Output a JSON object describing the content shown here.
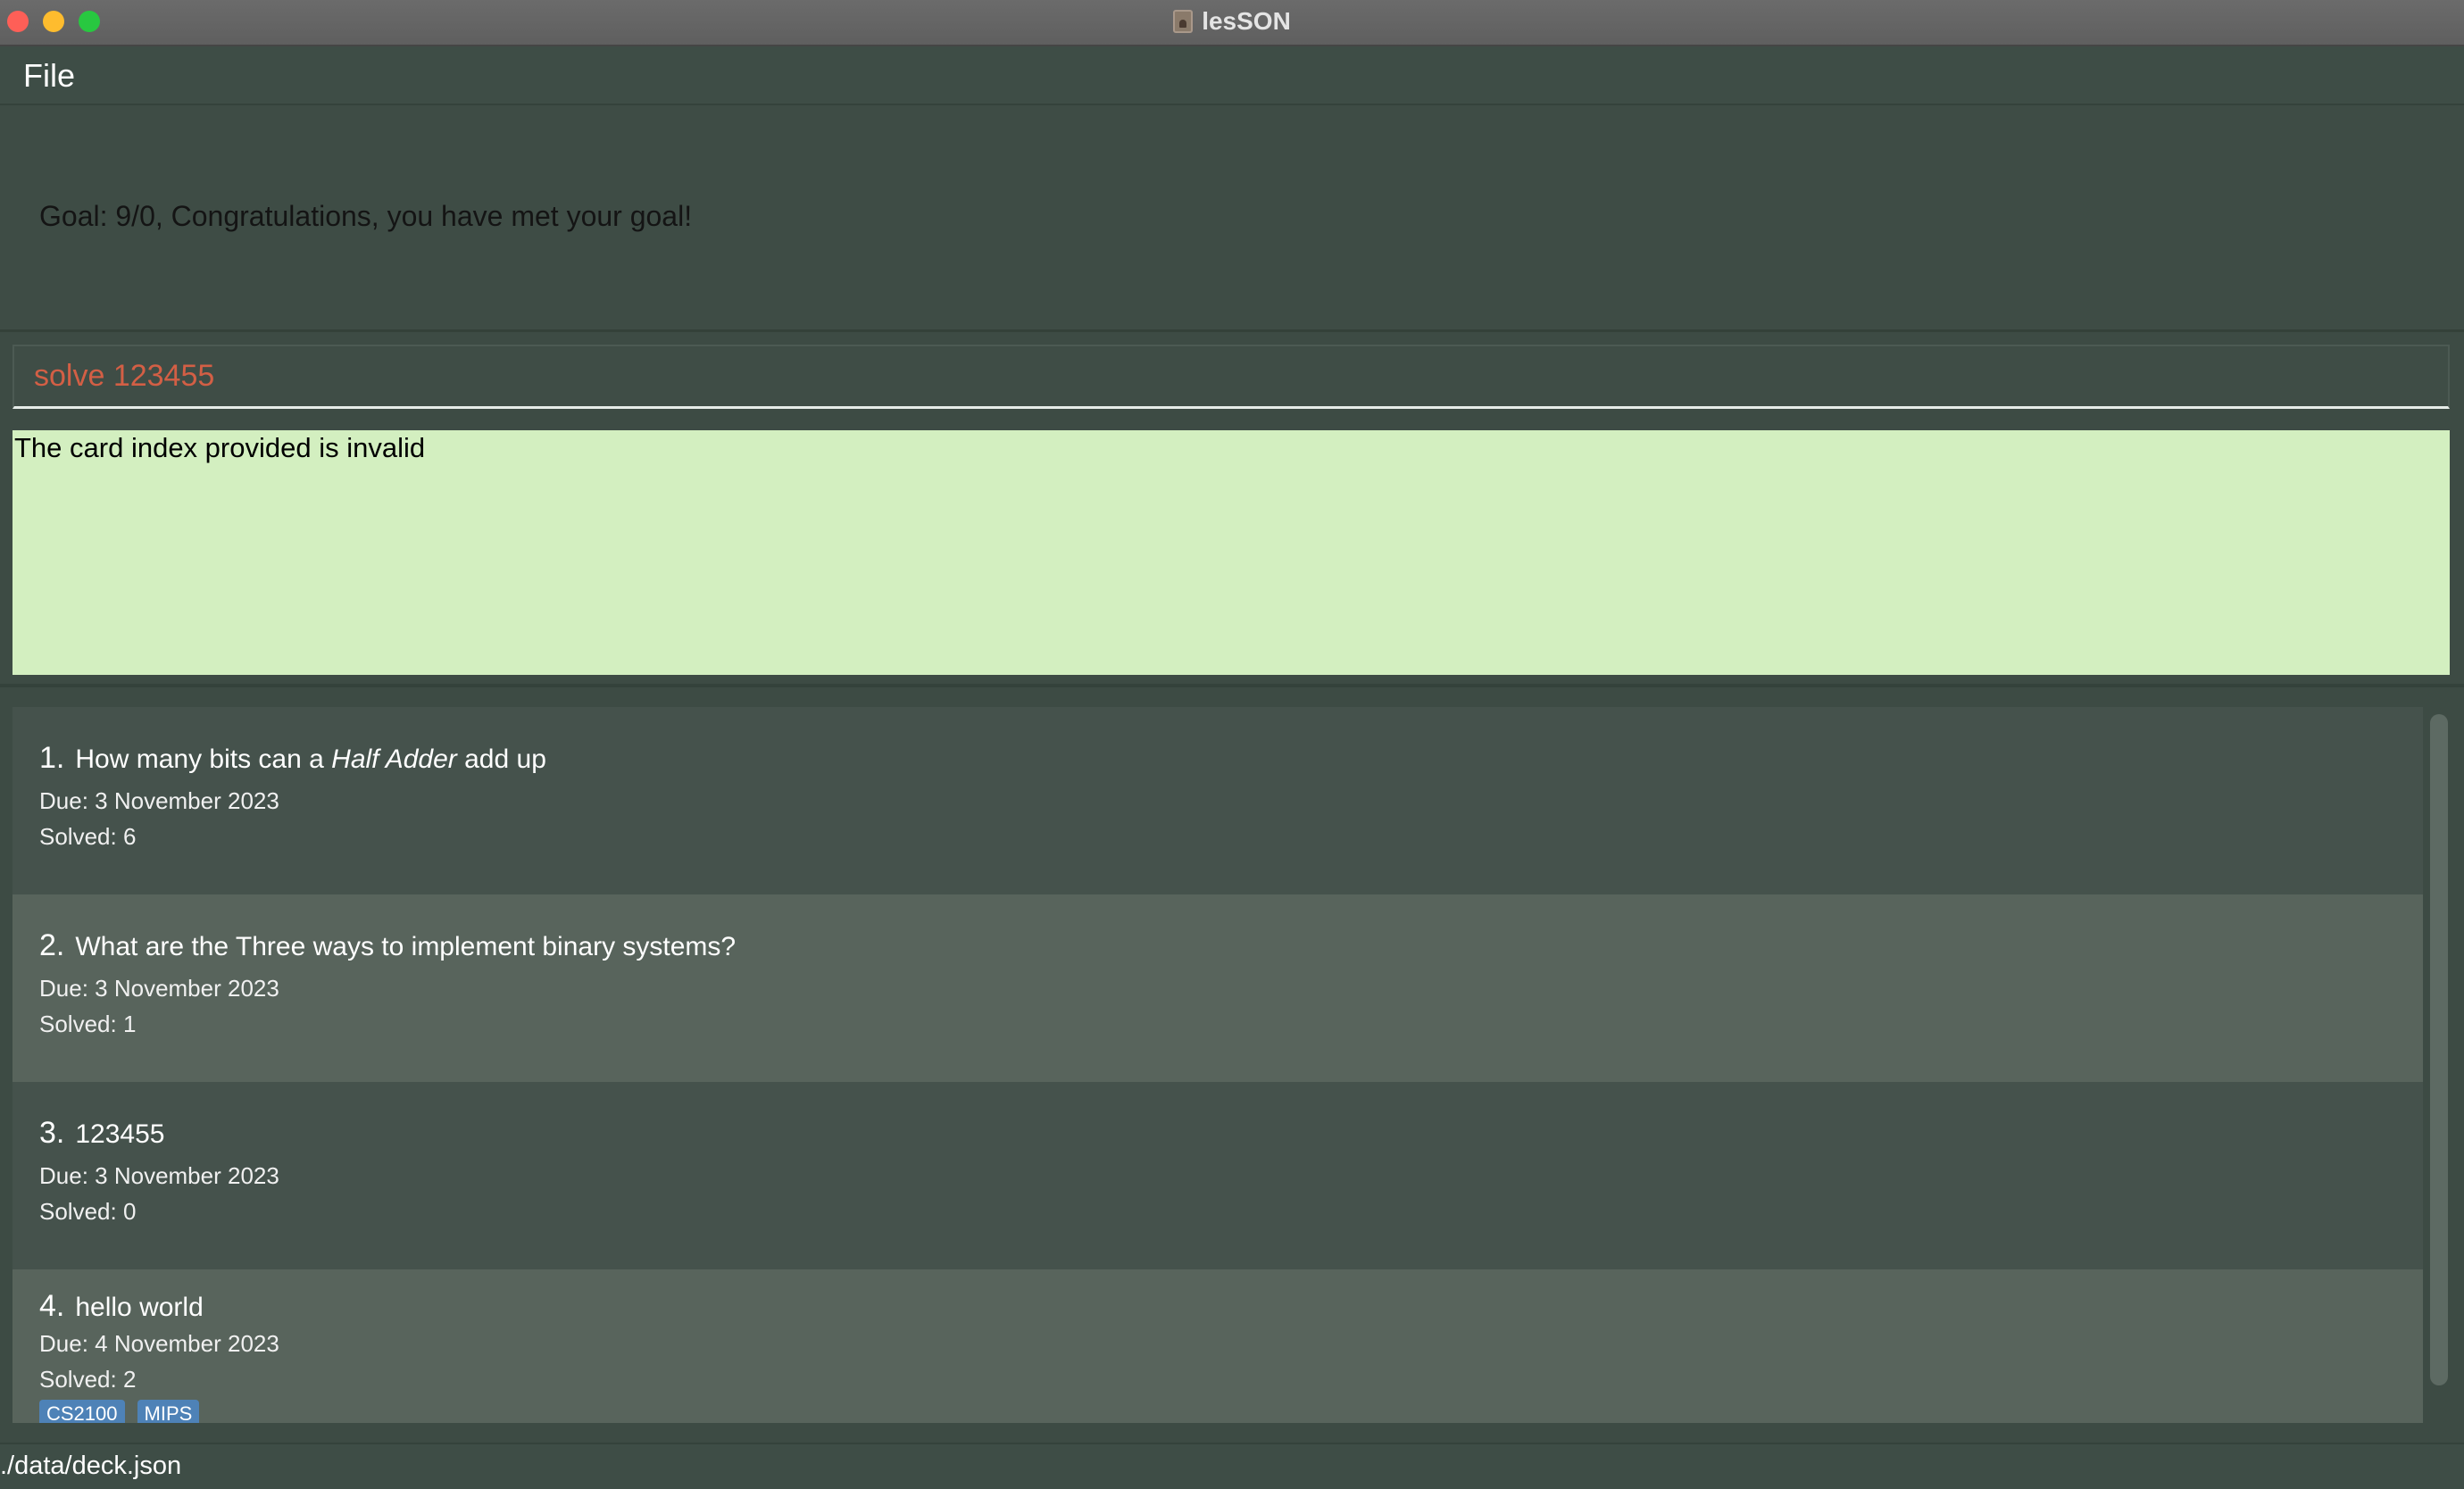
{
  "window": {
    "title": "lesSON",
    "app_icon": "app-icon"
  },
  "menu": {
    "file_label": "File"
  },
  "goal": {
    "text": "Goal: 9/0, Congratulations, you have met your goal!"
  },
  "command": {
    "value": "solve 123455"
  },
  "result": {
    "message": "The card index provided is invalid"
  },
  "cards": [
    {
      "index": "1.",
      "question_prefix": "How many bits can a ",
      "question_emphasis": "Half Adder",
      "question_suffix": " add up",
      "due": "Due: 3 November 2023",
      "solved": "Solved: 6",
      "tags": []
    },
    {
      "index": "2.",
      "question_prefix": "What are the Three ways to implement binary systems?",
      "question_emphasis": "",
      "question_suffix": "",
      "due": "Due: 3 November 2023",
      "solved": "Solved: 1",
      "tags": []
    },
    {
      "index": "3.",
      "question_prefix": "123455",
      "question_emphasis": "",
      "question_suffix": "",
      "due": "Due: 3 November 2023",
      "solved": "Solved: 0",
      "tags": []
    },
    {
      "index": "4.",
      "question_prefix": "hello world",
      "question_emphasis": "",
      "question_suffix": "",
      "due": "Due: 4 November 2023",
      "solved": "Solved: 2",
      "tags": [
        "CS2100",
        "MIPS"
      ]
    }
  ],
  "status": {
    "path": "./data/deck.json"
  },
  "colors": {
    "background": "#3d4b44",
    "result_background": "#d3efc0",
    "command_text": "#d35f45",
    "tag": "#4e82b7"
  }
}
